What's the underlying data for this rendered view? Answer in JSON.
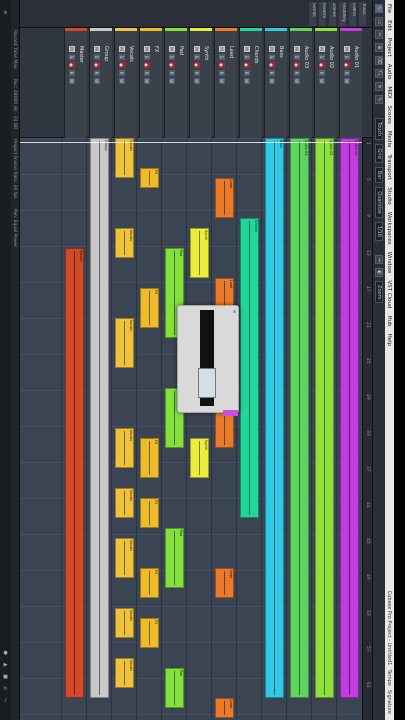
{
  "window": {
    "menu": [
      "File",
      "Edit",
      "Project",
      "Audio",
      "MIDI",
      "Scores",
      "Media",
      "Transport",
      "Studio",
      "Workspaces",
      "Window",
      "VST Cloud",
      "Hub",
      "Help"
    ],
    "title_items": [
      "Cubase Pro Project - Untitled1",
      "Tempo",
      "Signature"
    ]
  },
  "toolbar": {
    "buttons": [
      "Touch",
      "Grid",
      "Bar",
      "Quantize",
      "1/16"
    ],
    "fields": [
      "Grid",
      "1/16",
      "Touch"
    ],
    "zoom_label": "Zoom"
  },
  "inspector": {
    "items": [
      "Track",
      "Editor",
      "Visibility",
      "Zones",
      "Inserts",
      "Sends"
    ]
  },
  "tracks": [
    {
      "name": "Audio 01",
      "color": "#c43be0"
    },
    {
      "name": "Audio 02",
      "color": "#8ee03b"
    },
    {
      "name": "Audio 03",
      "color": "#5ed35e"
    },
    {
      "name": "Bass",
      "color": "#30c9e6"
    },
    {
      "name": "Chords",
      "color": "#1fd69b"
    },
    {
      "name": "Lead",
      "color": "#e87a2a"
    },
    {
      "name": "Synth",
      "color": "#ecec3a"
    },
    {
      "name": "Pad",
      "color": "#84e03b"
    },
    {
      "name": "FX",
      "color": "#eebc2a"
    },
    {
      "name": "Vocals",
      "color": "#f0c23a"
    },
    {
      "name": "Group",
      "color": "#c8c8c8"
    },
    {
      "name": "Master",
      "color": "#d24a2a"
    }
  ],
  "ruler": {
    "ticks": [
      "1",
      "5",
      "9",
      "13",
      "17",
      "21",
      "25",
      "29",
      "33",
      "37",
      "41",
      "45",
      "49",
      "53",
      "57",
      "61"
    ]
  },
  "popup": {
    "title": "Quick Controls",
    "close_label": "x"
  },
  "status": {
    "items": [
      "Record Time Max",
      "Rec: 48000 Hz - 24 Bit",
      "Project Frame Rate: 30 fps",
      "Pan: Equal Power"
    ]
  },
  "left_strip": {
    "icons": [
      "menu-icon",
      "record-icon",
      "play-icon",
      "stop-icon",
      "loop-icon",
      "metronome-icon"
    ]
  }
}
